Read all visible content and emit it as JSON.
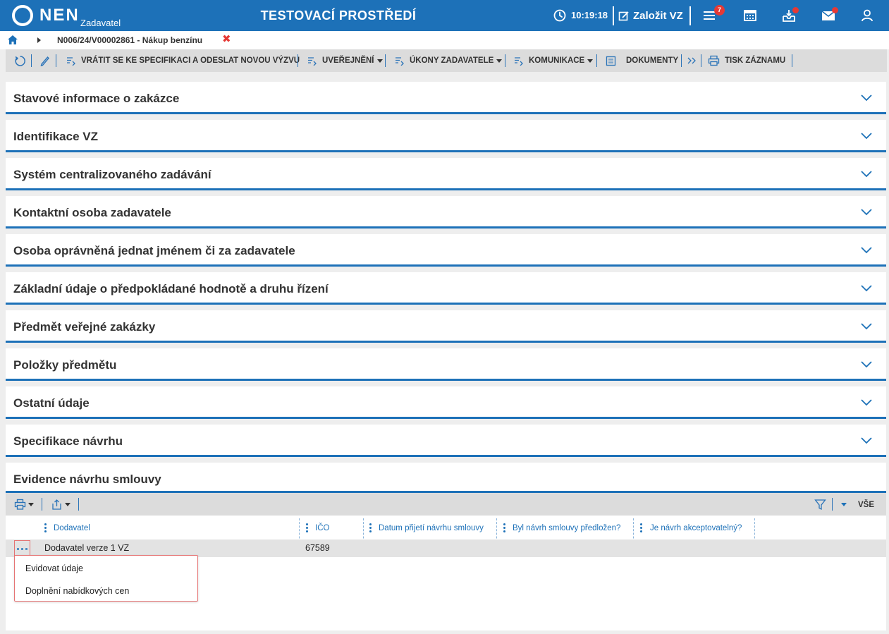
{
  "header": {
    "logo_text": "NEN",
    "logo_sub": "Zadavatel",
    "environment_title": "TESTOVACÍ PROSTŘEDÍ",
    "time": "10:19:18",
    "create_label": "Založit VZ",
    "tasks_badge": "7"
  },
  "breadcrumb": {
    "current": "N006/24/V00002861 - Nákup benzínu"
  },
  "toolbar": {
    "return_label": "VRÁTIT SE KE SPECIFIKACI A ODESLAT NOVOU VÝZVU",
    "publish_label": "UVEŘEJNĚNÍ",
    "actions_label": "ÚKONY ZADAVATELE",
    "communication_label": "KOMUNIKACE",
    "documents_label": "DOKUMENTY",
    "print_label": "TISK ZÁZNAMU"
  },
  "sections": [
    "Stavové informace o zakázce",
    "Identifikace VZ",
    "Systém centralizovaného zadávání",
    "Kontaktní osoba zadavatele",
    "Osoba oprávněná jednat jménem či za zadavatele",
    "Základní údaje o předpokládané hodnotě a druhu řízení",
    "Předmět veřejné zakázky",
    "Položky předmětu",
    "Ostatní údaje",
    "Specifikace návrhu"
  ],
  "evidence": {
    "title": "Evidence návrhu smlouvy",
    "filter_all_label": "VŠE",
    "columns": [
      "Dodavatel",
      "IČO",
      "Datum přijetí návrhu smlouvy",
      "Byl návrh smlouvy předložen?",
      "Je návrh akceptovatelný?"
    ],
    "rows": [
      {
        "dodavatel": "Dodavatel verze 1 VZ",
        "ico": "67589",
        "datum": "",
        "predlozen": "",
        "akceptovatelny": ""
      }
    ],
    "context_menu": [
      "Evidovat údaje",
      "Doplnění nabídkových cen"
    ]
  },
  "colors": {
    "primary": "#1d71b8",
    "badge": "#e53935",
    "toolbar_bg": "#dcdcdc",
    "page_bg": "#eeeeee"
  },
  "icons": {
    "header": [
      "clock-icon",
      "edit-icon",
      "tasks-menu-icon",
      "calendar-icon",
      "inbox-icon",
      "mail-icon",
      "user-icon"
    ],
    "toolbar": [
      "refresh-icon",
      "pencil-icon",
      "action-list-icon",
      "document-icon",
      "double-chevron-icon",
      "printer-icon"
    ],
    "grid": [
      "printer-icon",
      "export-icon",
      "filter-icon",
      "chevron-down-icon",
      "more-icon"
    ]
  }
}
